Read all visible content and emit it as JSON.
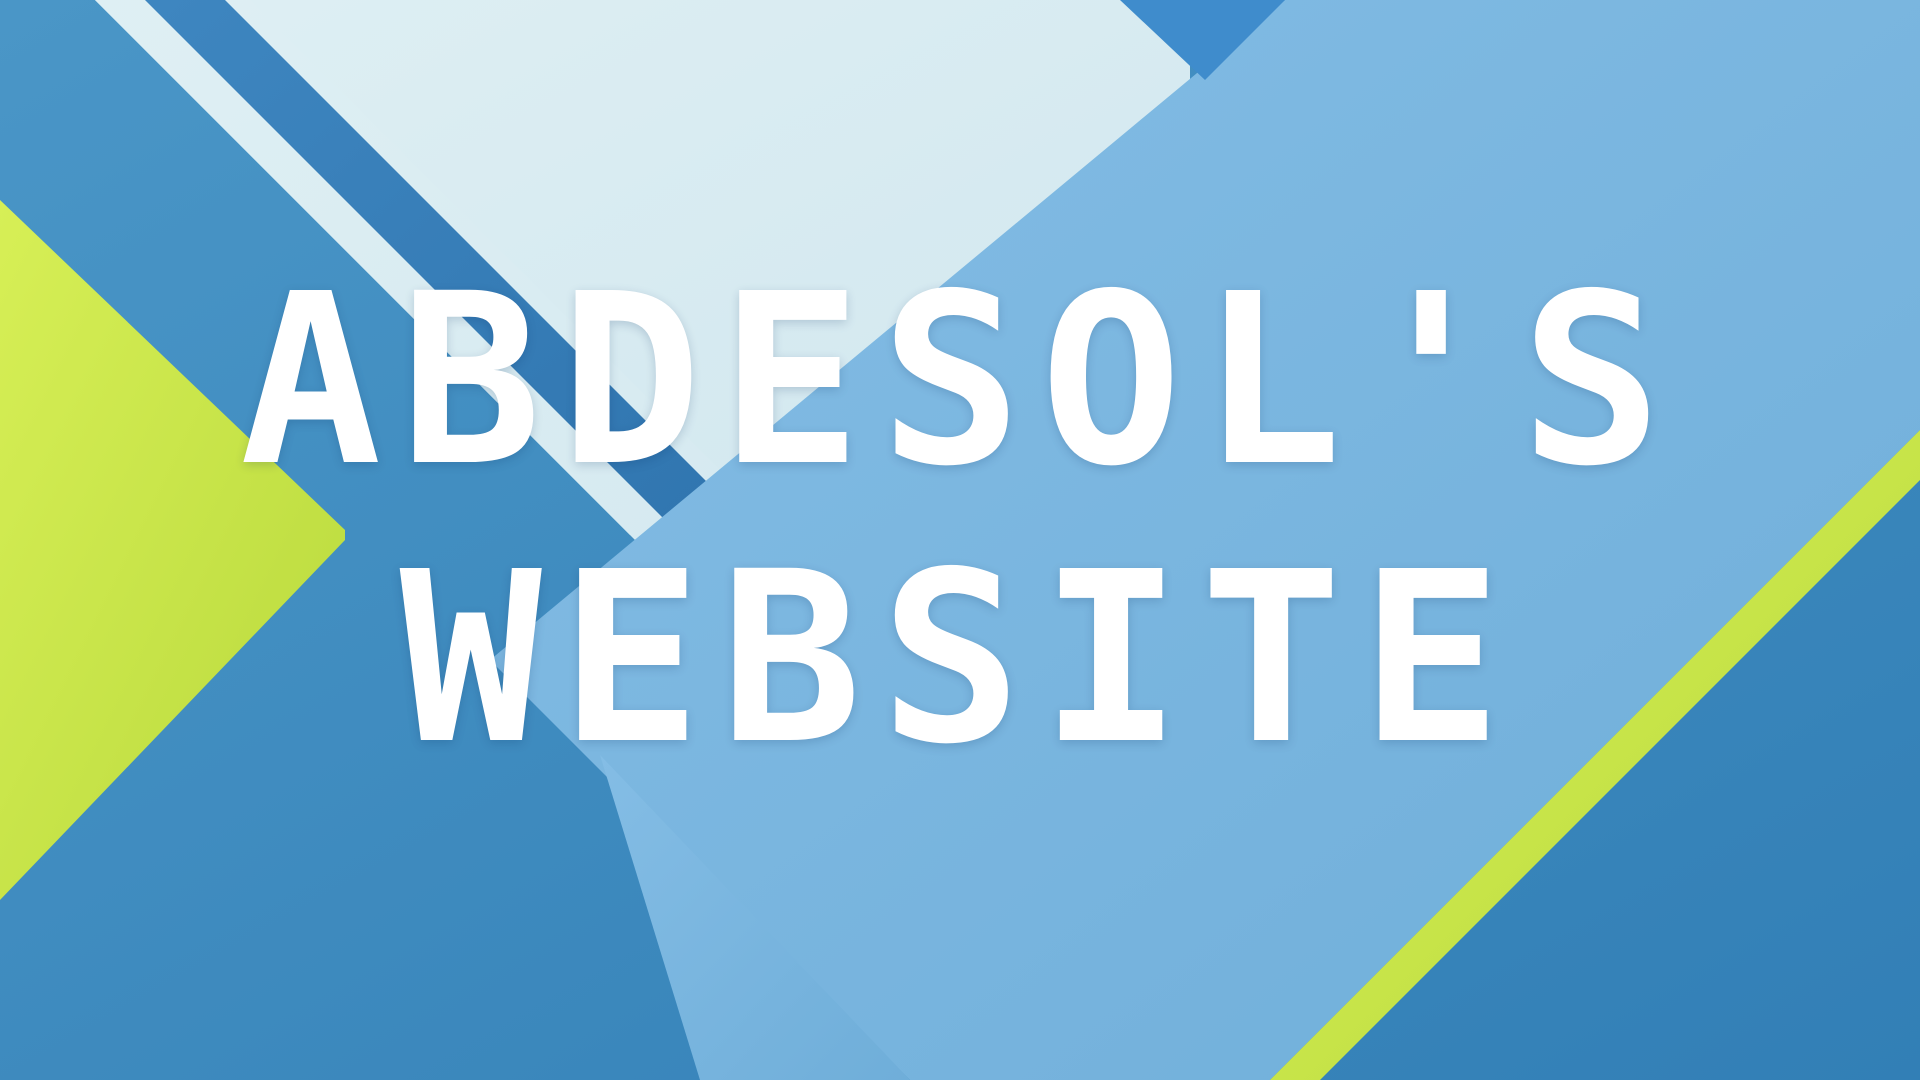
{
  "page": {
    "title_lines": [
      "ABDESOL'S",
      "WEBSITE"
    ]
  },
  "theme": {
    "background_base": "#3f8cc0",
    "panel_light": "#dceef3",
    "panel_sky": "#79b7e2",
    "panel_mid_blue": "#4d98cb",
    "accent_lime": "#cbe34a",
    "stripe_blue": "#2f78b2",
    "text_color": "#ffffff"
  }
}
